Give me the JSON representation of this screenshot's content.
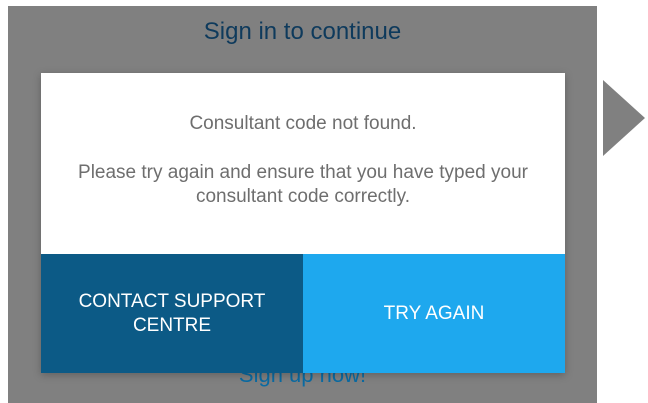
{
  "background": {
    "title": "Sign in to continue",
    "signup_link": "Sign up now!"
  },
  "dialog": {
    "title": "Consultant code not found.",
    "body": "Please try again and ensure that you have typed your consultant code correctly.",
    "buttons": {
      "contact_support": "CONTACT SUPPORT CENTRE",
      "try_again": "TRY AGAIN"
    }
  },
  "icons": {
    "next_arrow": "play-arrow-right-icon"
  },
  "colors": {
    "overlay": "#808080",
    "support_button": "#0c5a86",
    "try_again_button": "#1ea8ee",
    "dialog_background": "#ffffff",
    "message_text": "#6e6e6e"
  }
}
